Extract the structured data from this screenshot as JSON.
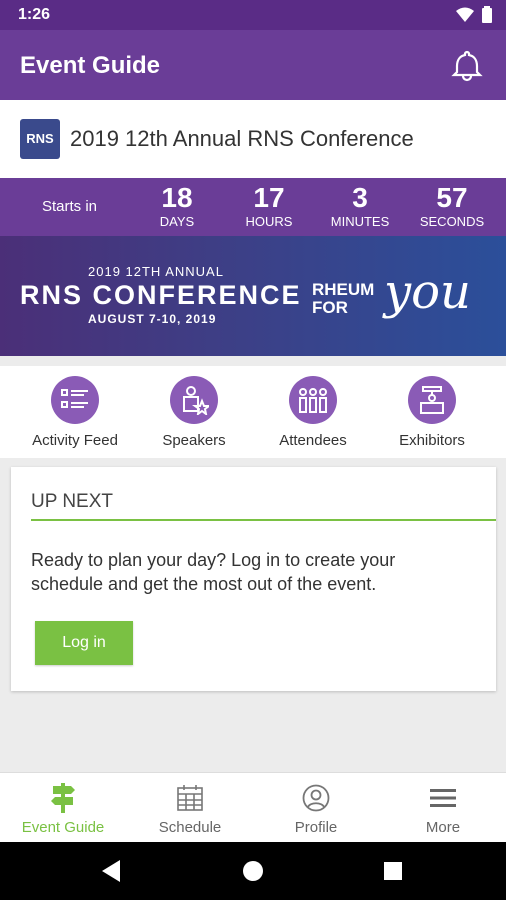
{
  "status": {
    "time": "1:26"
  },
  "app": {
    "title": "Event Guide"
  },
  "event": {
    "logo_text": "RNS",
    "name": "2019 12th Annual RNS Conference"
  },
  "countdown": {
    "starts_label": "Starts in",
    "units": [
      {
        "value": "18",
        "label": "DAYS"
      },
      {
        "value": "17",
        "label": "HOURS"
      },
      {
        "value": "3",
        "label": "MINUTES"
      },
      {
        "value": "57",
        "label": "SECONDS"
      }
    ]
  },
  "banner": {
    "subtitle": "2019 12TH ANNUAL",
    "title": "RNS CONFERENCE",
    "dates": "AUGUST 7-10, 2019",
    "tagline_line1": "RHEUM",
    "tagline_line2": "FOR",
    "tagline_script": "you"
  },
  "quicklinks": [
    {
      "label": "Activity Feed",
      "icon": "activity-feed-icon"
    },
    {
      "label": "Speakers",
      "icon": "speakers-icon"
    },
    {
      "label": "Attendees",
      "icon": "attendees-icon"
    },
    {
      "label": "Exhibitors",
      "icon": "exhibitors-icon"
    }
  ],
  "up_next": {
    "heading": "UP NEXT",
    "message": "Ready to plan your day? Log in to create your schedule and get the most out of the event.",
    "login_label": "Log in"
  },
  "bottom_nav": [
    {
      "label": "Event Guide",
      "icon": "signpost-icon",
      "active": true
    },
    {
      "label": "Schedule",
      "icon": "calendar-icon",
      "active": false
    },
    {
      "label": "Profile",
      "icon": "profile-icon",
      "active": false
    },
    {
      "label": "More",
      "icon": "menu-icon",
      "active": false
    }
  ],
  "colors": {
    "primary": "#6a3d97",
    "status_bar": "#5a2c86",
    "accent": "#7ac143",
    "icon_circle": "#8a5bb6"
  }
}
